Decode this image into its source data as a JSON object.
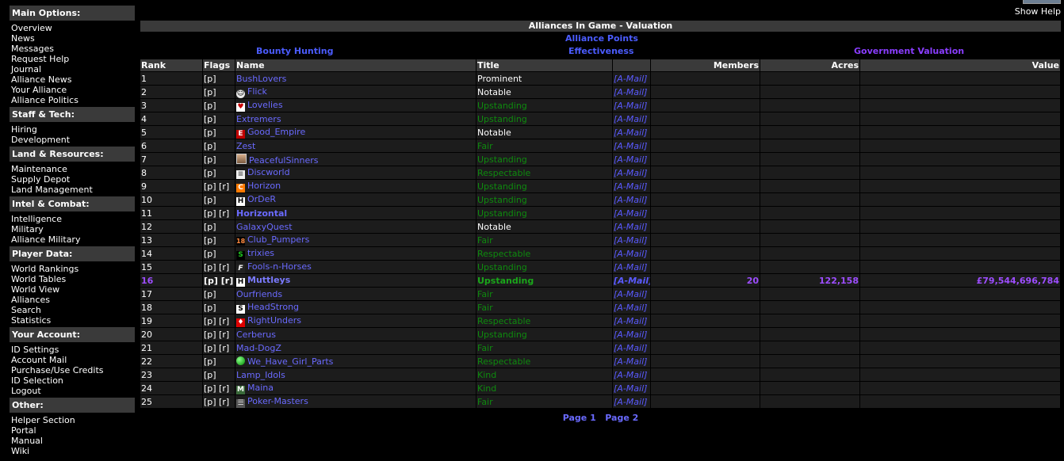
{
  "help": {
    "label": "Show Help"
  },
  "sidebar": {
    "sections": [
      {
        "title": "Main Options:",
        "items": [
          "Overview",
          "News",
          "Messages",
          "Request Help",
          "Journal",
          "Alliance News",
          "Your Alliance",
          "Alliance Politics"
        ]
      },
      {
        "title": "Staff & Tech:",
        "items": [
          "Hiring",
          "Development"
        ]
      },
      {
        "title": "Land & Resources:",
        "items": [
          "Maintenance",
          "Supply Depot",
          "Land Management"
        ]
      },
      {
        "title": "Intel & Combat:",
        "items": [
          "Intelligence",
          "Military",
          "Alliance Military"
        ]
      },
      {
        "title": "Player Data:",
        "items": [
          "World Rankings",
          "World Tables",
          "World View",
          "Alliances",
          "Search",
          "Statistics"
        ]
      },
      {
        "title": "Your Account:",
        "items": [
          "ID Settings",
          "Account Mail",
          "Purchase/Use Credits",
          "ID Selection",
          "Logout"
        ]
      },
      {
        "title": "Other:",
        "items": [
          "Helper Section",
          "Portal",
          "Manual",
          "Wiki"
        ]
      }
    ]
  },
  "main": {
    "title": "Alliances In Game - Valuation",
    "links": {
      "alliance_points": "Alliance Points",
      "bounty_hunting": "Bounty Hunting",
      "effectiveness": "Effectiveness",
      "government_valuation": "Government Valuation"
    },
    "columns": [
      "Rank",
      "Flags",
      "Name",
      "Title",
      "",
      "Members",
      "Acres",
      "Value"
    ],
    "amail_label": "[A-Mail]",
    "rows": [
      {
        "rank": "1",
        "flags": "[p]",
        "icon": "",
        "name": "BushLovers",
        "title": "Prominent",
        "tcls": "t-prominent"
      },
      {
        "rank": "2",
        "flags": "[p]",
        "icon": "smiley",
        "name": "Flick",
        "title": "Notable",
        "tcls": "t-notable"
      },
      {
        "rank": "3",
        "flags": "[p]",
        "icon": "heart",
        "name": "Lovelies",
        "title": "Upstanding",
        "tcls": "t-green"
      },
      {
        "rank": "4",
        "flags": "[p]",
        "icon": "",
        "name": "Extremers",
        "title": "Upstanding",
        "tcls": "t-green"
      },
      {
        "rank": "5",
        "flags": "[p]",
        "icon": "e-logo",
        "name": "Good_Empire",
        "title": "Notable",
        "tcls": "t-notable"
      },
      {
        "rank": "6",
        "flags": "[p]",
        "icon": "",
        "name": "Zest",
        "title": "Fair",
        "tcls": "t-green"
      },
      {
        "rank": "7",
        "flags": "[p]",
        "icon": "picture",
        "name": "PeacefulSinners",
        "title": "Upstanding",
        "tcls": "t-green"
      },
      {
        "rank": "8",
        "flags": "[p]",
        "icon": "book",
        "name": "Discworld",
        "title": "Respectable",
        "tcls": "t-green"
      },
      {
        "rank": "9",
        "flags": "[p] [r]",
        "icon": "orange-c",
        "name": "Horizon",
        "title": "Upstanding",
        "tcls": "t-green"
      },
      {
        "rank": "10",
        "flags": "[p]",
        "icon": "h-box",
        "name": "OrDeR",
        "title": "Upstanding",
        "tcls": "t-green"
      },
      {
        "rank": "11",
        "flags": "[p] [r]",
        "icon": "",
        "name": "Horizontal",
        "title": "Upstanding",
        "tcls": "t-green",
        "bold": true
      },
      {
        "rank": "12",
        "flags": "[p]",
        "icon": "",
        "name": "GalaxyQuest",
        "title": "Notable",
        "tcls": "t-notable"
      },
      {
        "rank": "13",
        "flags": "[p]",
        "icon": "eighteen",
        "name": "Club_Pumpers",
        "title": "Fair",
        "tcls": "t-green"
      },
      {
        "rank": "14",
        "flags": "[p]",
        "icon": "green-s",
        "name": "trixies",
        "title": "Respectable",
        "tcls": "t-green"
      },
      {
        "rank": "15",
        "flags": "[p] [r]",
        "icon": "f-box",
        "name": "Fools-n-Horses",
        "title": "Upstanding",
        "tcls": "t-green"
      },
      {
        "rank": "16",
        "flags": "[p] [r]",
        "icon": "h-box",
        "name": "Muttleys",
        "title": "Upstanding",
        "tcls": "t-green",
        "highlight": true,
        "members": "20",
        "acres": "122,158",
        "value": "£79,544,696,784"
      },
      {
        "rank": "17",
        "flags": "[p]",
        "icon": "",
        "name": "Ourfriends",
        "title": "Fair",
        "tcls": "t-green"
      },
      {
        "rank": "18",
        "flags": "[p]",
        "icon": "s-box",
        "name": "HeadStrong",
        "title": "Fair",
        "tcls": "t-green"
      },
      {
        "rank": "19",
        "flags": "[p] [r]",
        "icon": "canada",
        "name": "RightUnders",
        "title": "Respectable",
        "tcls": "t-green"
      },
      {
        "rank": "20",
        "flags": "[p] [r]",
        "icon": "",
        "name": "Cerberus",
        "title": "Upstanding",
        "tcls": "t-green"
      },
      {
        "rank": "21",
        "flags": "[p] [r]",
        "icon": "",
        "name": "Mad-DogZ",
        "title": "Fair",
        "tcls": "t-green"
      },
      {
        "rank": "22",
        "flags": "[p]",
        "icon": "green-ball",
        "name": "We_Have_Girl_Parts",
        "title": "Respectable",
        "tcls": "t-green"
      },
      {
        "rank": "23",
        "flags": "[p]",
        "icon": "",
        "name": "Lamp_Idols",
        "title": "Kind",
        "tcls": "t-green"
      },
      {
        "rank": "24",
        "flags": "[p] [r]",
        "icon": "m-box",
        "name": "Maina",
        "title": "Kind",
        "tcls": "t-green"
      },
      {
        "rank": "25",
        "flags": "[p] [r]",
        "icon": "rss",
        "name": "Poker-Masters",
        "title": "Fair",
        "tcls": "t-green"
      }
    ],
    "pager": [
      "Page 1",
      "Page 2"
    ]
  }
}
